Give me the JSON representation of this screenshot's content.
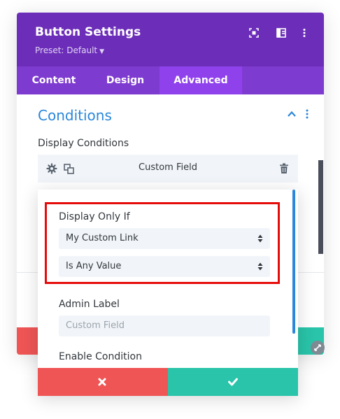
{
  "header": {
    "title": "Button Settings",
    "preset_label": "Preset: Default"
  },
  "tabs": [
    {
      "label": "Content",
      "active": false
    },
    {
      "label": "Design",
      "active": false
    },
    {
      "label": "Advanced",
      "active": true
    }
  ],
  "section": {
    "title": "Conditions"
  },
  "display_conditions": {
    "label": "Display Conditions",
    "condition_name": "Custom Field"
  },
  "modal": {
    "display_only_if_label": "Display Only If",
    "field_select_value": "My Custom Link",
    "operator_select_value": "Is Any Value",
    "admin_label_label": "Admin Label",
    "admin_label_placeholder": "Custom Field",
    "enable_condition_label": "Enable Condition"
  },
  "colors": {
    "header_purple": "#6c2eb9",
    "tabs_purple": "#7e3bd0",
    "active_tab": "#8f42ec",
    "accent_blue": "#2b87da",
    "cancel_red": "#ef5555",
    "save_green": "#29c4a9",
    "highlight_red": "#e60b0b"
  },
  "icons": {
    "header": [
      "focus-icon",
      "sidebar-layout-icon",
      "more-vertical-icon"
    ],
    "condition_bar": [
      "gear-icon",
      "duplicate-icon",
      "trash-icon"
    ],
    "buttons": [
      "close-icon",
      "check-icon"
    ]
  }
}
